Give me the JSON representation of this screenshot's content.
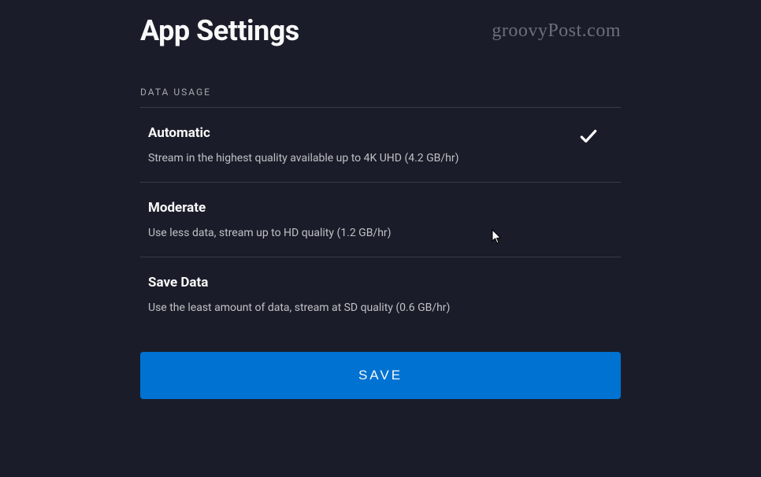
{
  "page": {
    "title": "App Settings",
    "watermark": "groovyPost.com"
  },
  "section": {
    "label": "DATA USAGE"
  },
  "options": [
    {
      "title": "Automatic",
      "description": "Stream in the highest quality available up to 4K UHD (4.2 GB/hr)",
      "selected": true
    },
    {
      "title": "Moderate",
      "description": "Use less data, stream up to HD quality (1.2 GB/hr)",
      "selected": false
    },
    {
      "title": "Save Data",
      "description": "Use the least amount of data, stream at SD quality (0.6 GB/hr)",
      "selected": false
    }
  ],
  "buttons": {
    "save": "SAVE"
  }
}
